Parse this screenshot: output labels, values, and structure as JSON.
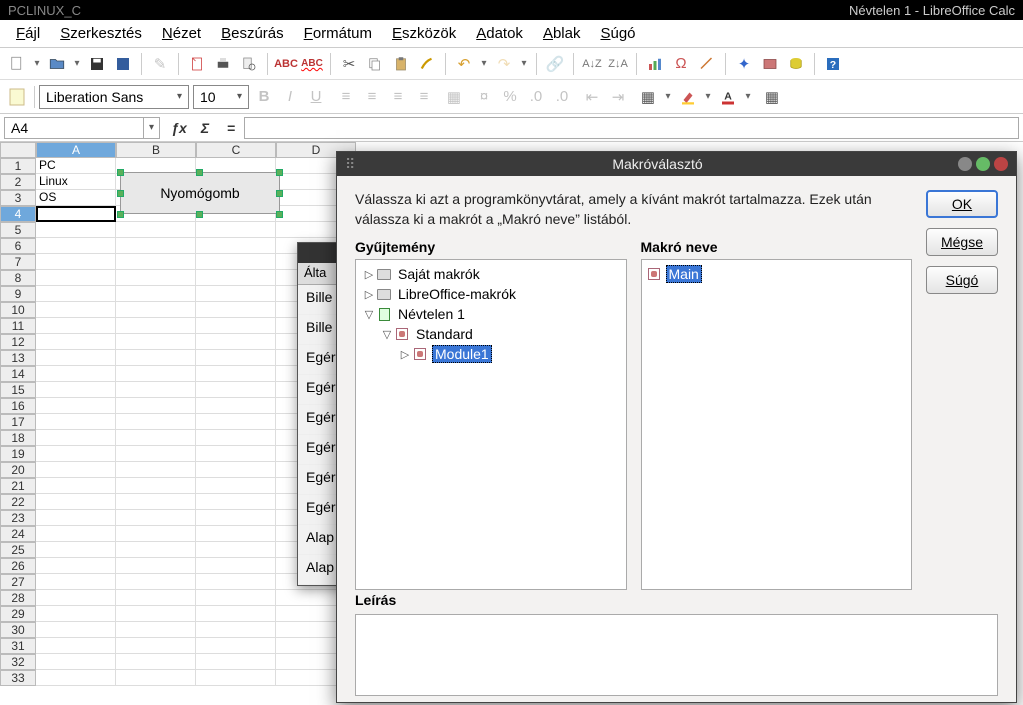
{
  "window": {
    "left_title": "PCLINUX_C",
    "right_title": "Névtelen 1 - LibreOffice Calc"
  },
  "menubar": [
    {
      "u": "F",
      "rest": "ájl"
    },
    {
      "u": "S",
      "rest": "zerkesztés"
    },
    {
      "u": "N",
      "rest": "ézet"
    },
    {
      "u": "B",
      "rest": "eszúrás"
    },
    {
      "u": "F",
      "rest": "ormátum"
    },
    {
      "u": "E",
      "rest": "szközök"
    },
    {
      "u": "A",
      "rest": "datok"
    },
    {
      "u": "A",
      "rest": "blak"
    },
    {
      "u": "S",
      "rest": "úgó"
    }
  ],
  "formatbar": {
    "font_name": "Liberation Sans",
    "font_size": "10"
  },
  "formula": {
    "name_box": "A4"
  },
  "sheet": {
    "columns": [
      "A",
      "B",
      "C",
      "D"
    ],
    "rows": 33,
    "selected_col": "A",
    "selected_row": 4,
    "cells": {
      "A1": "PC",
      "A2": "Linux",
      "A3": "OS"
    },
    "button_label": "Nyomógomb"
  },
  "underdialog": {
    "tab": "Álta",
    "rows": [
      "Bille",
      "Bille",
      "Egér",
      "Egér",
      "Egér",
      "Egér",
      "Egér",
      "Egér",
      "Alap",
      "Alap"
    ]
  },
  "macrodlg": {
    "title": "Makróválasztó",
    "desc": "Válassza ki azt a programkönyvtárat, amely a kívánt makrót tartalmazza. Ezek után válassza ki a makrót a „Makró neve” listából.",
    "col1_title": "Gyűjtemény",
    "col2_title": "Makró neve",
    "tree": {
      "my_macros": "Saját makrók",
      "lo_macros": "LibreOffice-makrók",
      "doc": "Névtelen 1",
      "lib": "Standard",
      "module": "Module1"
    },
    "macro_name": "Main",
    "desc_title": "Leírás",
    "buttons": {
      "ok": "OK",
      "cancel": "Mégse",
      "help": "Súgó"
    }
  }
}
